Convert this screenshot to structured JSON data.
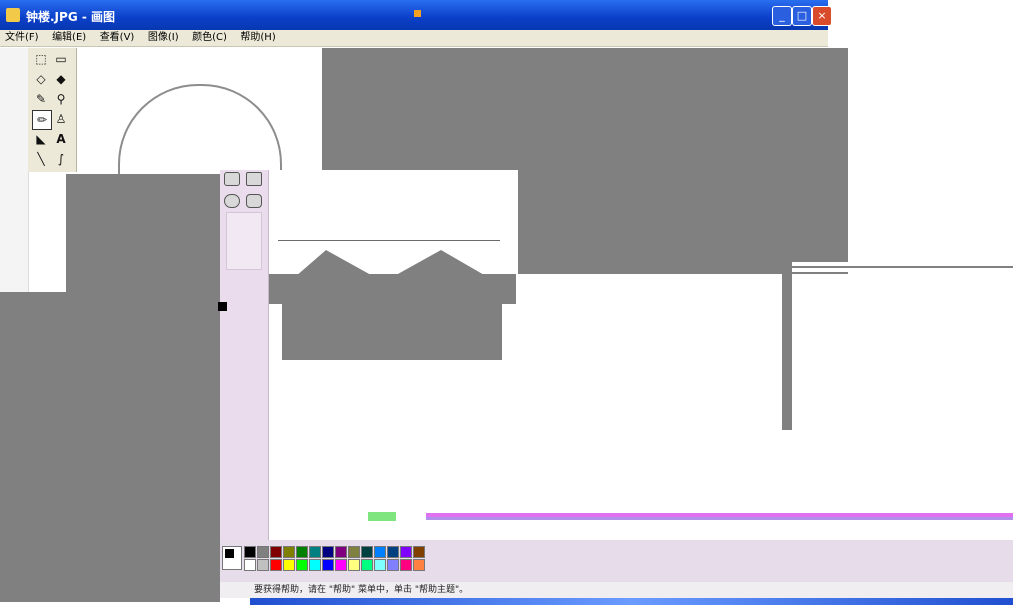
{
  "window": {
    "title": "钟楼.JPG - 画图",
    "controls": {
      "minimize": "_",
      "maximize": "□",
      "close": "×"
    }
  },
  "menu": [
    {
      "label": "文件(F)"
    },
    {
      "label": "编辑(E)"
    },
    {
      "label": "查看(V)"
    },
    {
      "label": "图像(I)"
    },
    {
      "label": "颜色(C)"
    },
    {
      "label": "帮助(H)"
    }
  ],
  "status": {
    "text": "要获得帮助，请在 \"帮助\" 菜单中，单击 \"帮助主题\"。"
  },
  "palette": {
    "row1": [
      "#000000",
      "#808080",
      "#800000",
      "#808000",
      "#008000",
      "#008080",
      "#000080",
      "#800080",
      "#808040",
      "#004040",
      "#0080ff",
      "#004080",
      "#8000ff",
      "#804000"
    ],
    "row2": [
      "#ffffff",
      "#c0c0c0",
      "#ff0000",
      "#ffff00",
      "#00ff00",
      "#00ffff",
      "#0000ff",
      "#ff00ff",
      "#ffff80",
      "#00ff80",
      "#80ffff",
      "#8080ff",
      "#ff0080",
      "#ff8040"
    ]
  }
}
